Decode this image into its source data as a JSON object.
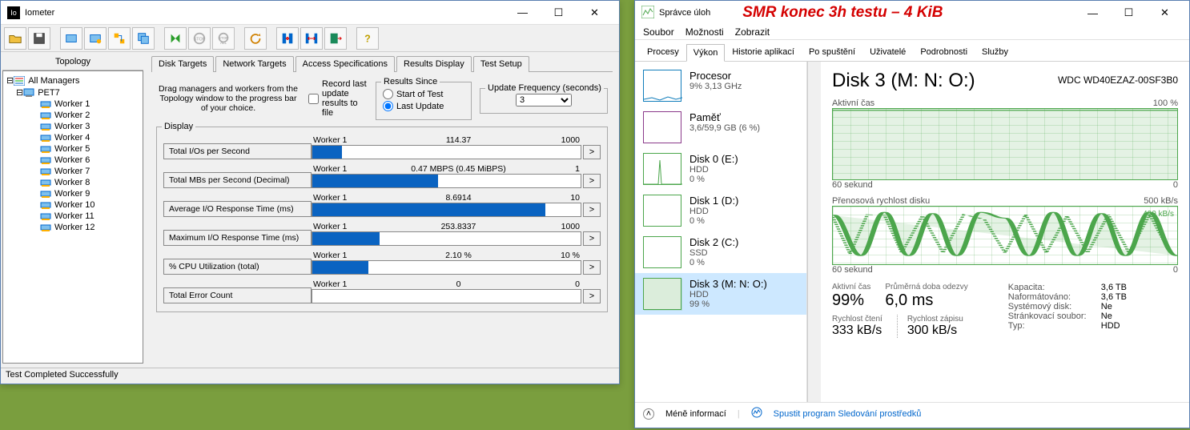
{
  "iometer": {
    "title": "Iometer",
    "topology_label": "Topology",
    "tree": {
      "root": "All Managers",
      "host": "PET7",
      "workers": [
        "Worker 1",
        "Worker 2",
        "Worker 3",
        "Worker 4",
        "Worker 5",
        "Worker 6",
        "Worker 7",
        "Worker 8",
        "Worker 9",
        "Worker 10",
        "Worker 11",
        "Worker 12"
      ]
    },
    "tabs": [
      "Disk Targets",
      "Network Targets",
      "Access Specifications",
      "Results Display",
      "Test Setup"
    ],
    "active_tab": 3,
    "hint": "Drag managers and workers from the Topology window to the progress bar of your choice.",
    "record_checkbox": "Record last update results to file",
    "results_since": {
      "title": "Results Since",
      "opt1": "Start of Test",
      "opt2": "Last Update",
      "selected": 1
    },
    "update_freq": {
      "title": "Update Frequency (seconds)",
      "value": "3"
    },
    "display_label": "Display",
    "metrics": [
      {
        "label": "Total I/Os per Second",
        "who": "Worker 1",
        "value": "114.37",
        "max": "1000",
        "pct": 11
      },
      {
        "label": "Total MBs per Second (Decimal)",
        "who": "Worker 1",
        "value": "0.47 MBPS (0.45 MiBPS)",
        "max": "1",
        "pct": 47
      },
      {
        "label": "Average I/O Response Time (ms)",
        "who": "Worker 1",
        "value": "8.6914",
        "max": "10",
        "pct": 87
      },
      {
        "label": "Maximum I/O Response Time (ms)",
        "who": "Worker 1",
        "value": "253.8337",
        "max": "1000",
        "pct": 25
      },
      {
        "label": "% CPU Utilization (total)",
        "who": "Worker 1",
        "value": "2.10 %",
        "max": "10 %",
        "pct": 21
      },
      {
        "label": "Total Error Count",
        "who": "Worker 1",
        "value": "0",
        "max": "0",
        "pct": 0
      }
    ],
    "status": "Test Completed Successfully"
  },
  "taskmgr": {
    "title": "Správce úloh",
    "red_annotation": "SMR   konec 3h testu – 4 KiB",
    "menu": [
      "Soubor",
      "Možnosti",
      "Zobrazit"
    ],
    "tabs": [
      "Procesy",
      "Výkon",
      "Historie aplikací",
      "Po spuštění",
      "Uživatelé",
      "Podrobnosti",
      "Služby"
    ],
    "active_tab": 1,
    "left": [
      {
        "title": "Procesor",
        "sub": "9% 3,13 GHz",
        "color": "blue"
      },
      {
        "title": "Paměť",
        "sub": "3,6/59,9 GB (6 %)",
        "color": "purple"
      },
      {
        "title": "Disk 0 (E:)",
        "sub": "HDD",
        "sub2": "0 %",
        "color": "green"
      },
      {
        "title": "Disk 1 (D:)",
        "sub": "HDD",
        "sub2": "0 %",
        "color": "green"
      },
      {
        "title": "Disk 2 (C:)",
        "sub": "SSD",
        "sub2": "0 %",
        "color": "green"
      },
      {
        "title": "Disk 3 (M: N: O:)",
        "sub": "HDD",
        "sub2": "99 %",
        "color": "green",
        "selected": true
      }
    ],
    "right": {
      "title": "Disk 3 (M: N: O:)",
      "model": "WDC WD40EZAZ-00SF3B0",
      "chart1": {
        "title": "Aktivní čas",
        "max": "100 %",
        "foot_left": "60 sekund",
        "foot_right": "0"
      },
      "chart2": {
        "title": "Přenosová rychlost disku",
        "max": "500 kB/s",
        "inner_label": "490 kB/s",
        "foot_left": "60 sekund",
        "foot_right": "0"
      },
      "stats": {
        "active_lbl": "Aktivní čas",
        "active_val": "99%",
        "resp_lbl": "Průměrná doba odezvy",
        "resp_val": "6,0 ms",
        "read_lbl": "Rychlost čtení",
        "read_val": "333 kB/s",
        "write_lbl": "Rychlost zápisu",
        "write_val": "300 kB/s"
      },
      "props": [
        [
          "Kapacita:",
          "3,6 TB"
        ],
        [
          "Naformátováno:",
          "3,6 TB"
        ],
        [
          "Systémový disk:",
          "Ne"
        ],
        [
          "Stránkovací soubor:",
          "Ne"
        ],
        [
          "Typ:",
          "HDD"
        ]
      ]
    },
    "bottom": {
      "less": "Méně informací",
      "link": "Spustit program Sledování prostředků"
    }
  }
}
